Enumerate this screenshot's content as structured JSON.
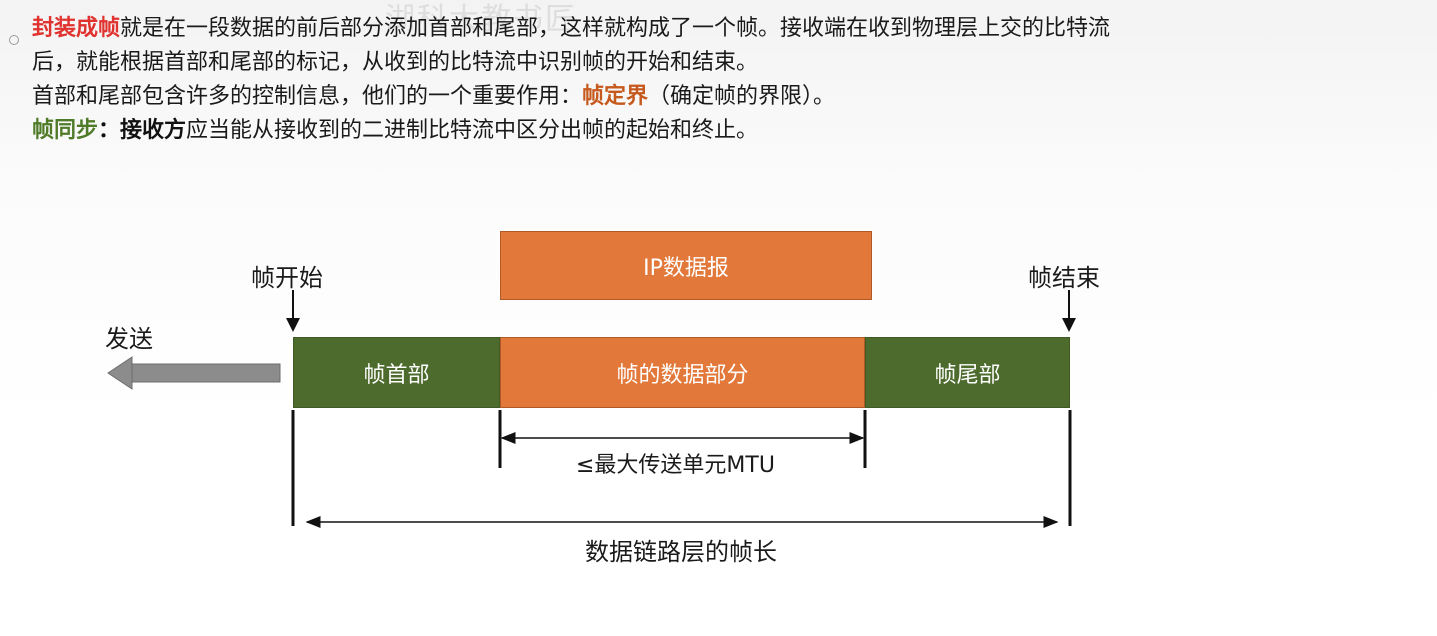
{
  "watermark": "湖科大教书匠",
  "text": {
    "line1": {
      "term": "封装成帧",
      "rest": "就是在一段数据的前后部分添加首部和尾部，这样就构成了一个帧。接收端在收到物理层上交的比特流"
    },
    "line2": "后，就能根据首部和尾部的标记，从收到的比特流中识别帧的开始和结束。",
    "line3": {
      "prefix": "首部和尾部包含许多的控制信息，他们的一个重要作用：",
      "term": "帧定界",
      "suffix": "（确定帧的界限）。"
    },
    "line4": {
      "term": "帧同步",
      "colon": "：",
      "subject": "接收方",
      "rest": "应当能从接收到的二进制比特流中区分出帧的起始和终止。"
    }
  },
  "diagram": {
    "ip_datagram": "IP数据报",
    "frame_header": "帧首部",
    "frame_data": "帧的数据部分",
    "frame_trailer": "帧尾部",
    "frame_start": "帧开始",
    "frame_end": "帧结束",
    "send": "发送",
    "mtu": "≤最大传送单元MTU",
    "frame_length": "数据链路层的帧长"
  },
  "colors": {
    "header_trailer": "#4e6b2e",
    "data": "#e2783a",
    "term_red": "#e0322e",
    "term_orange": "#c65a1e",
    "term_green": "#4f7a28",
    "send_arrow": "#8c8c8c"
  }
}
